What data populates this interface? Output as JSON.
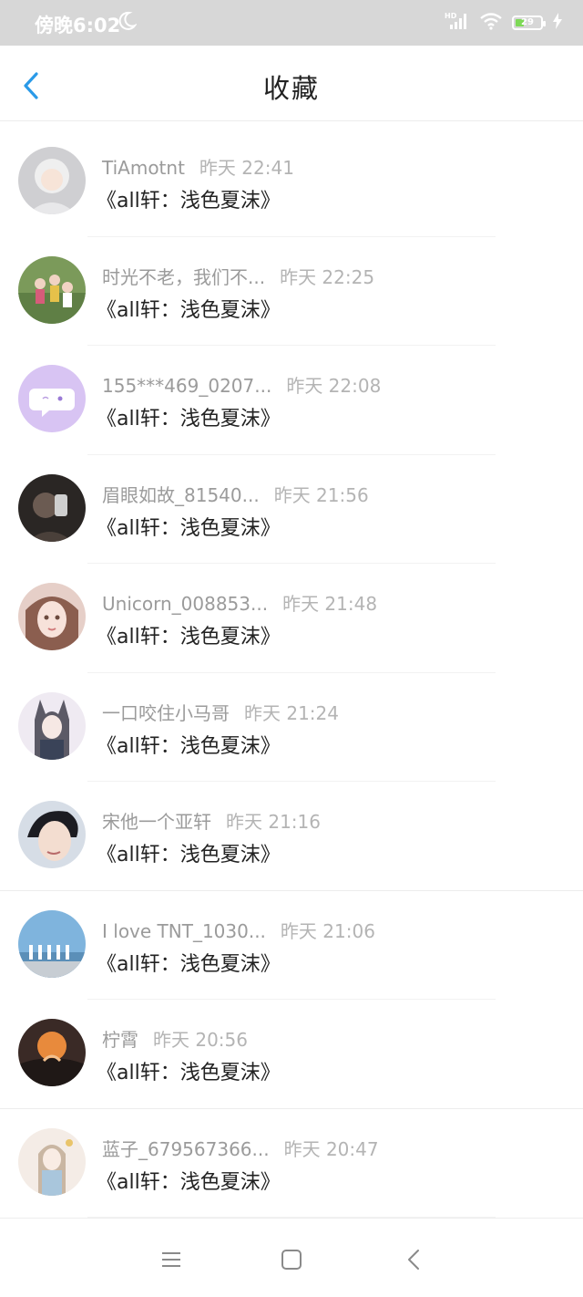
{
  "status_bar": {
    "time": "傍晚6:02",
    "battery_level": "29",
    "battery_color": "#7ed957"
  },
  "header": {
    "title": "收藏",
    "accent_color": "#2a9ae8"
  },
  "items": [
    {
      "user": "TiAmotnt",
      "time": "昨天 22:41",
      "title": "《all轩：浅色夏沫》"
    },
    {
      "user": "时光不老，我们不...",
      "time": "昨天 22:25",
      "title": "《all轩：浅色夏沫》"
    },
    {
      "user": "155***469_0207...",
      "time": "昨天 22:08",
      "title": "《all轩：浅色夏沫》"
    },
    {
      "user": "眉眼如故_81540...",
      "time": "昨天 21:56",
      "title": "《all轩：浅色夏沫》"
    },
    {
      "user": "Unicorn_008853...",
      "time": "昨天 21:48",
      "title": "《all轩：浅色夏沫》"
    },
    {
      "user": "一口咬住小马哥",
      "time": "昨天 21:24",
      "title": "《all轩：浅色夏沫》"
    },
    {
      "user": "宋他一个亚轩",
      "time": "昨天 21:16",
      "title": "《all轩：浅色夏沫》"
    },
    {
      "user": "I love TNT_1030...",
      "time": "昨天 21:06",
      "title": "《all轩：浅色夏沫》"
    },
    {
      "user": "柠霄",
      "time": "昨天 20:56",
      "title": "《all轩：浅色夏沫》"
    },
    {
      "user": "蓝子_679567366...",
      "time": "昨天 20:47",
      "title": "《all轩：浅色夏沫》"
    }
  ],
  "nav": {
    "menu_icon": "menu-icon",
    "home_icon": "home-icon",
    "back_icon": "back-icon"
  }
}
